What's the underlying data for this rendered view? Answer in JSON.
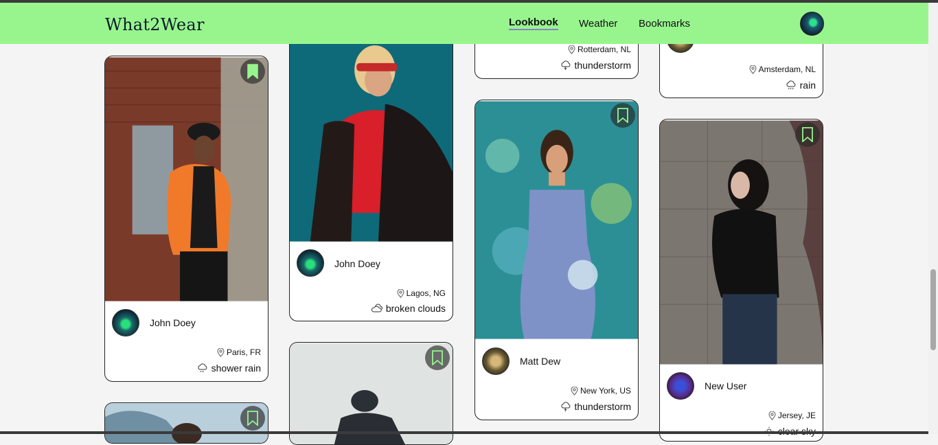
{
  "brand": "What2Wear",
  "nav": {
    "lookbook": "Lookbook",
    "weather": "Weather",
    "bookmarks": "Bookmarks"
  },
  "colors": {
    "navbar": "#98f58e",
    "bookmark_active": "#98f58e",
    "accent_underline": "#8e7fc9"
  },
  "cards": [
    {
      "user": "John Doey",
      "location": "Paris, FR",
      "weather": "shower rain",
      "bookmarked": true
    },
    {
      "user": "",
      "location": "",
      "weather": "",
      "bookmarked": false
    },
    {
      "user": "John Doey",
      "location": "Lagos, NG",
      "weather": "broken clouds",
      "bookmarked": false
    },
    {
      "user": "",
      "location": "",
      "weather": "",
      "bookmarked": false
    },
    {
      "user": "",
      "location": "Rotterdam, NL",
      "weather": "thunderstorm",
      "bookmarked": false
    },
    {
      "user": "Matt Dew",
      "location": "New York, US",
      "weather": "thunderstorm",
      "bookmarked": false
    },
    {
      "user": "",
      "location": "Amsterdam, NL",
      "weather": "rain",
      "bookmarked": false
    },
    {
      "user": "New User",
      "location": "Jersey, JE",
      "weather": "clear sky",
      "bookmarked": false
    }
  ]
}
